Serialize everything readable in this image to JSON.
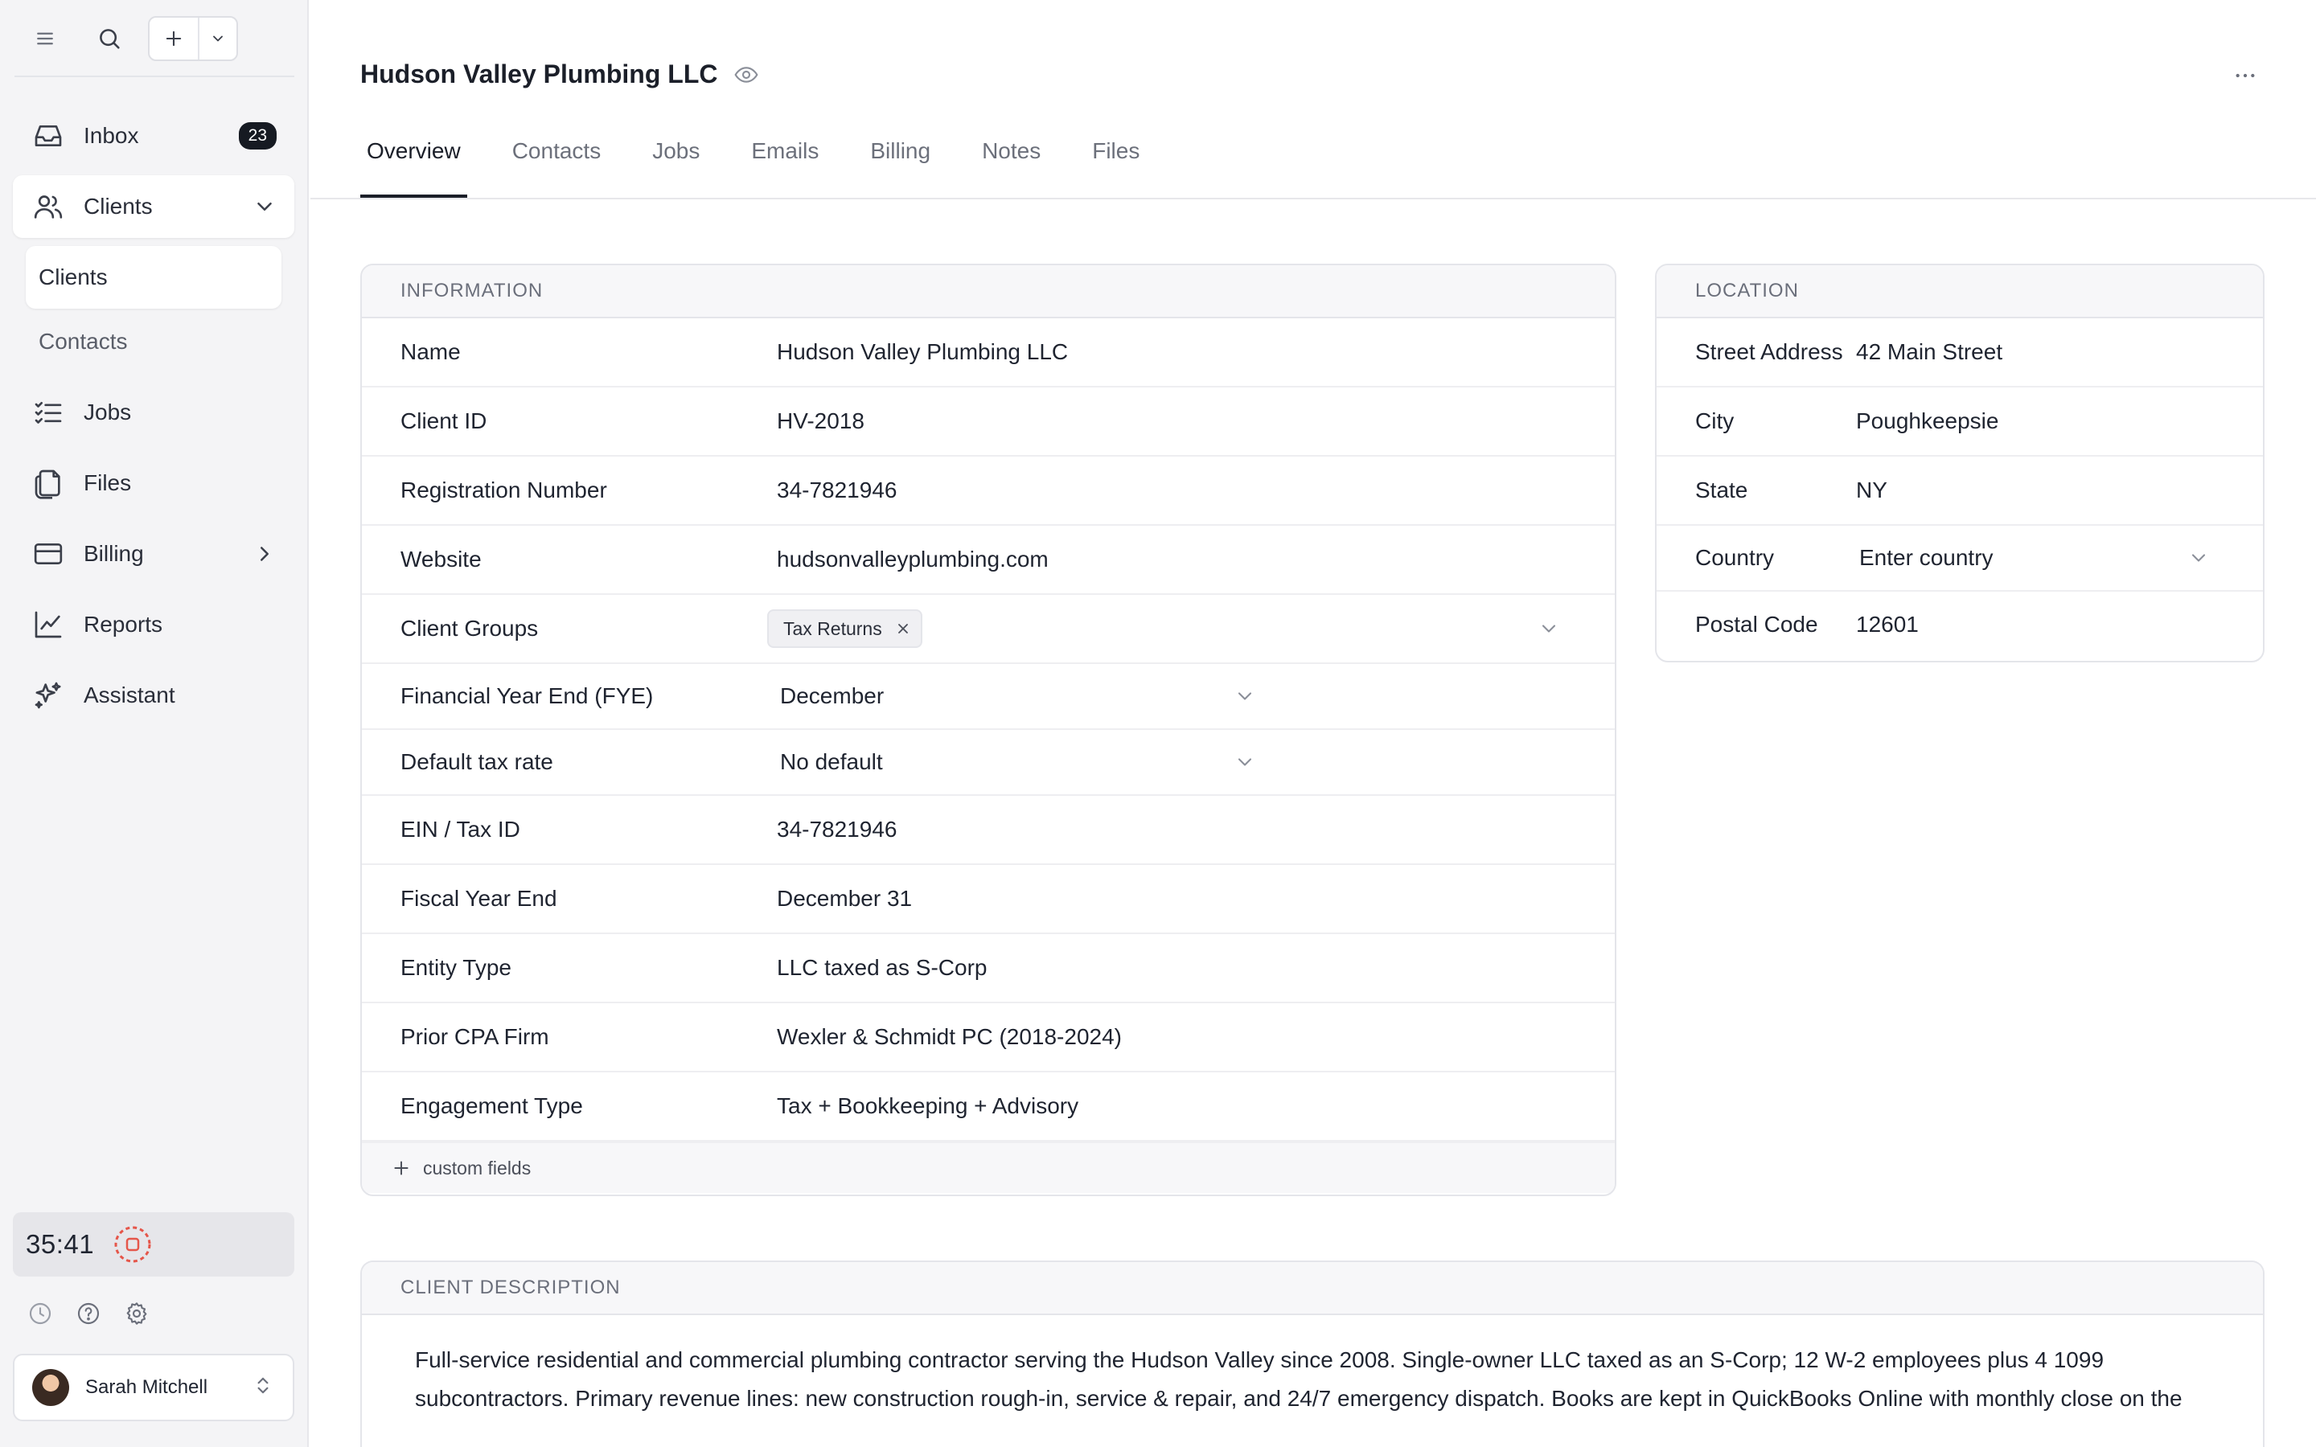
{
  "sidebar": {
    "items": [
      {
        "label": "Inbox",
        "badge": "23"
      },
      {
        "label": "Clients"
      },
      {
        "label": "Jobs"
      },
      {
        "label": "Files"
      },
      {
        "label": "Billing"
      },
      {
        "label": "Reports"
      },
      {
        "label": "Assistant"
      }
    ],
    "sub_items": [
      {
        "label": "Clients"
      },
      {
        "label": "Contacts"
      }
    ],
    "timer": "35:41",
    "user_name": "Sarah Mitchell"
  },
  "page": {
    "title": "Hudson Valley Plumbing LLC",
    "tabs": [
      "Overview",
      "Contacts",
      "Jobs",
      "Emails",
      "Billing",
      "Notes",
      "Files"
    ],
    "active_tab": "Overview"
  },
  "information": {
    "heading": "INFORMATION",
    "rows": [
      {
        "label": "Name",
        "value": "Hudson Valley Plumbing LLC"
      },
      {
        "label": "Client ID",
        "value": "HV-2018"
      },
      {
        "label": "Registration Number",
        "value": "34-7821946"
      },
      {
        "label": "Website",
        "value": "hudsonvalleyplumbing.com"
      },
      {
        "label": "Client Groups",
        "chip": "Tax Returns"
      },
      {
        "label": "Financial Year End (FYE)",
        "value": "December"
      },
      {
        "label": "Default tax rate",
        "value": "No default"
      },
      {
        "label": "EIN / Tax ID",
        "value": "34-7821946"
      },
      {
        "label": "Fiscal Year End",
        "value": "December 31"
      },
      {
        "label": "Entity Type",
        "value": "LLC taxed as S-Corp"
      },
      {
        "label": "Prior CPA Firm",
        "value": "Wexler & Schmidt PC (2018-2024)"
      },
      {
        "label": "Engagement Type",
        "value": "Tax + Bookkeeping + Advisory"
      }
    ],
    "custom_fields_label": "custom fields"
  },
  "location": {
    "heading": "LOCATION",
    "rows": [
      {
        "label": "Street Address",
        "value": "42 Main Street"
      },
      {
        "label": "City",
        "value": "Poughkeepsie"
      },
      {
        "label": "State",
        "value": "NY"
      },
      {
        "label": "Country",
        "placeholder": "Enter country"
      },
      {
        "label": "Postal Code",
        "value": "12601"
      }
    ]
  },
  "description": {
    "heading": "CLIENT DESCRIPTION",
    "text": "Full-service residential and commercial plumbing contractor serving the Hudson Valley since 2008. Single-owner LLC taxed as an S-Corp; 12 W-2 employees plus 4 1099 subcontractors. Primary revenue lines: new construction rough-in, service & repair, and 24/7 emergency dispatch. Books are kept in QuickBooks Online with monthly close on the"
  }
}
